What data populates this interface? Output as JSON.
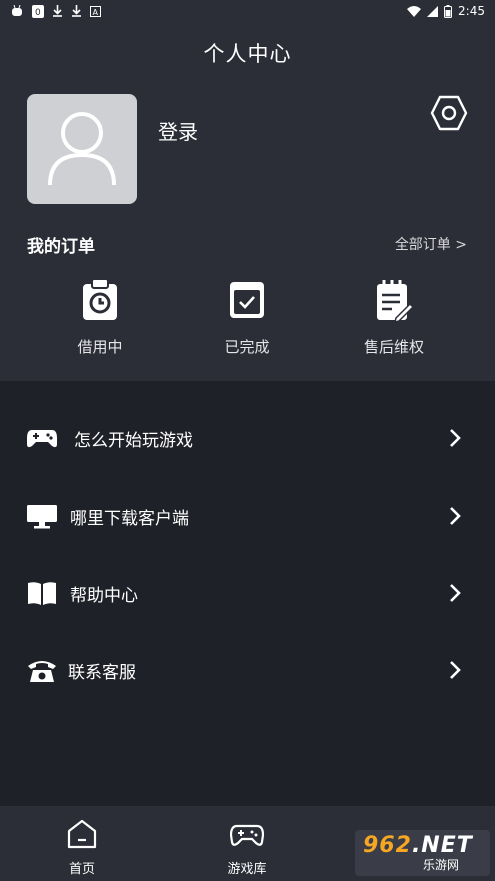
{
  "status_bar": {
    "time": "2:45",
    "left_icons": [
      "bug-icon",
      "shield-icon",
      "download-icon",
      "download-icon",
      "a-icon"
    ],
    "right_icons": [
      "wifi-icon",
      "signal-icon",
      "battery-icon"
    ]
  },
  "header": {
    "title": "个人中心"
  },
  "profile": {
    "login_label": "登录"
  },
  "orders": {
    "title": "我的订单",
    "all_link": "全部订单 >",
    "items": [
      {
        "label": "借用中",
        "icon": "clipboard-clock-icon"
      },
      {
        "label": "已完成",
        "icon": "checkbox-icon"
      },
      {
        "label": "售后维权",
        "icon": "notepad-edit-icon"
      }
    ]
  },
  "menu": [
    {
      "label": "怎么开始玩游戏",
      "icon": "gamepad-icon"
    },
    {
      "label": "哪里下载客户端",
      "icon": "monitor-icon"
    },
    {
      "label": "帮助中心",
      "icon": "book-icon"
    },
    {
      "label": "联系客服",
      "icon": "telephone-icon"
    }
  ],
  "bottom_nav": [
    {
      "label": "首页",
      "icon": "home-icon"
    },
    {
      "label": "游戏库",
      "icon": "gamepad-icon"
    }
  ],
  "watermark": {
    "brand_number": "962",
    "brand_net": ".NET",
    "subtitle": "乐游网"
  },
  "colors": {
    "background": "#1f2128",
    "panel": "#2b2e36",
    "avatar_bg": "#cfd0d3",
    "watermark_accent": "#f5a623"
  }
}
